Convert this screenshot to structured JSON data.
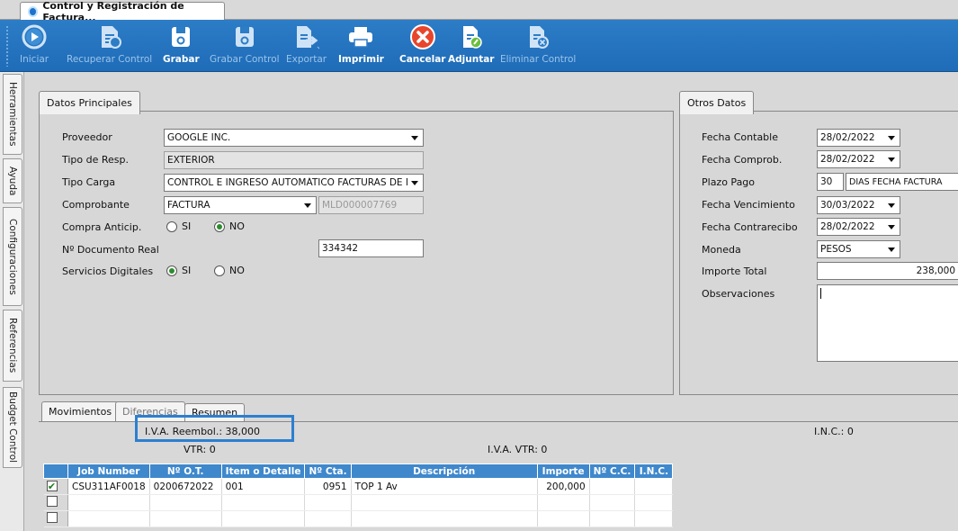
{
  "window": {
    "tab_title": "Control y Registración de Factura..."
  },
  "toolbar": {
    "buttons": [
      {
        "label": "Iniciar",
        "enabled": false
      },
      {
        "label": "Recuperar Control",
        "enabled": false
      },
      {
        "label": "Grabar",
        "enabled": true
      },
      {
        "label": "Grabar Control",
        "enabled": false
      },
      {
        "label": "Exportar",
        "enabled": false
      },
      {
        "label": "Imprimir",
        "enabled": true
      },
      {
        "label": "Cancelar",
        "enabled": true
      },
      {
        "label": "Adjuntar",
        "enabled": true
      },
      {
        "label": "Eliminar Control",
        "enabled": false
      }
    ]
  },
  "sidebar": {
    "tabs": [
      "Herramientas",
      "Ayuda",
      "Configuraciones",
      "Referencias",
      "Budget Control"
    ]
  },
  "principal": {
    "title": "Datos Principales",
    "proveedor_label": "Proveedor",
    "proveedor_value": "GOOGLE INC.",
    "tipo_resp_label": "Tipo de Resp.",
    "tipo_resp_value": "EXTERIOR",
    "tipo_carga_label": "Tipo Carga",
    "tipo_carga_value": "CONTROL E INGRESO AUTOMÁTICO FACTURAS DE MED",
    "comprobante_label": "Comprobante",
    "comprobante_value": "FACTURA",
    "comprobante_code": "MLD000007769",
    "compra_label": "Compra Anticip.",
    "opt_si": "SI",
    "opt_no": "NO",
    "nro_doc_label": "Nº Documento Real",
    "nro_doc_value": "334342",
    "servicios_label": "Servicios Digitales"
  },
  "otros": {
    "title": "Otros Datos",
    "fecha_contable_label": "Fecha Contable",
    "fecha_contable_value": "28/02/2022",
    "fecha_comprob_label": "Fecha Comprob.",
    "fecha_comprob_value": "28/02/2022",
    "plazo_label": "Plazo Pago",
    "plazo_dias": "30",
    "plazo_tipo": "DIAS FECHA FACTURA",
    "fecha_venc_label": "Fecha Vencimiento",
    "fecha_venc_value": "30/03/2022",
    "fecha_contra_label": "Fecha Contrarecibo",
    "fecha_contra_value": "28/02/2022",
    "moneda_label": "Moneda",
    "moneda_value": "PESOS",
    "importe_label": "Importe Total",
    "importe_value": "238,000",
    "obs_label": "Observaciones"
  },
  "bottom": {
    "tabs": [
      "Movimientos",
      "Diferencias",
      "Resumen"
    ],
    "iva_reembol": "I.V.A. Reembol.: 38,000",
    "vtr": "VTR: 0",
    "iva_vtr": "I.V.A. VTR: 0",
    "inc": "I.N.C.: 0"
  },
  "grid": {
    "columns": [
      "Job Number",
      "Nº O.T.",
      "Item o Detalle",
      "Nº Cta.",
      "Descripción",
      "Importe",
      "Nº C.C.",
      "I.N.C."
    ],
    "rows": [
      {
        "checked": true,
        "cells": [
          "CSU311AF0018",
          "0200672022",
          "001",
          "0951",
          "TOP 1 Av",
          "200,000",
          "",
          ""
        ]
      },
      {
        "checked": false,
        "cells": [
          "",
          "",
          "",
          "",
          "",
          "",
          "",
          ""
        ]
      },
      {
        "checked": false,
        "cells": [
          "",
          "",
          "",
          "",
          "",
          "",
          "",
          ""
        ]
      }
    ]
  },
  "colors": {
    "ribbon": "#2c7cc6",
    "grid_header": "#3f88cc",
    "highlight": "#2d7fd0",
    "radio_selected": "#2e8b2e"
  }
}
